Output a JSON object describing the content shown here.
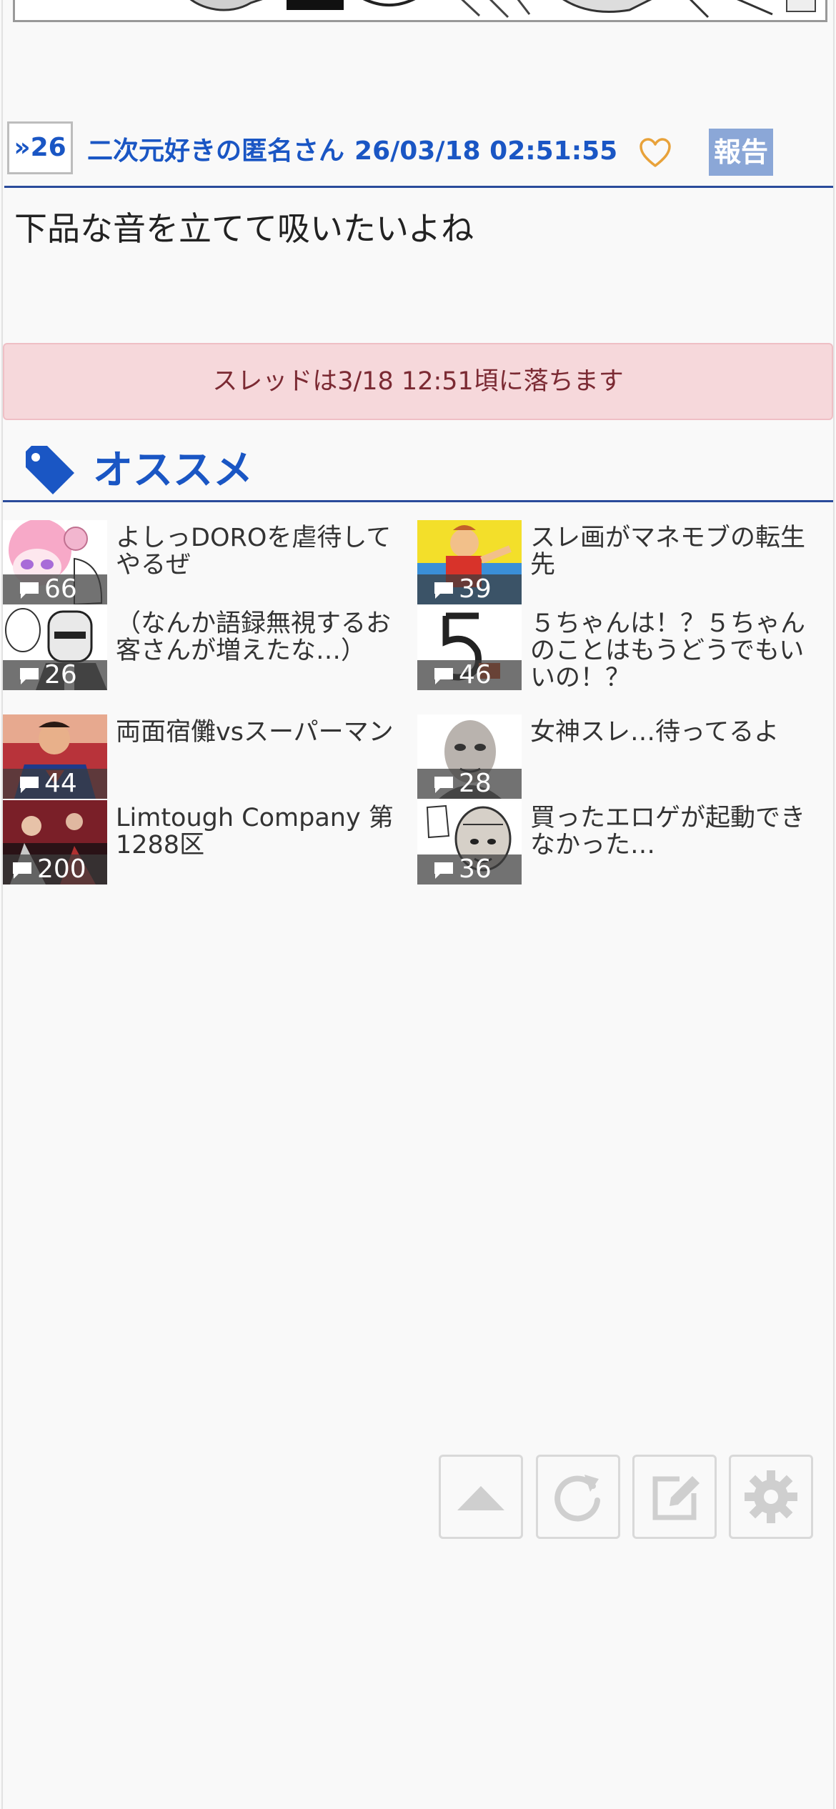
{
  "post": {
    "res_number": "»26",
    "poster_name": "二次元好きの匿名さん",
    "timestamp": "26/03/18 02:51:55",
    "report_label": "報告",
    "body": "下品な音を立てて吸いたいよね"
  },
  "notice": {
    "text": "スレッドは3/18 12:51頃に落ちます"
  },
  "recommend": {
    "heading": "オススメ",
    "items": [
      {
        "title": "よしっDOROを虐待してやるぜ",
        "count": "66"
      },
      {
        "title": "スレ画がマネモブの転生先",
        "count": "39"
      },
      {
        "title": "（なんか語録無視するお客さんが増えたな…）",
        "count": "26"
      },
      {
        "title": "５ちゃんは！？５ちゃんのことはもうどうでもいいの！？",
        "count": "46"
      },
      {
        "title": "両面宿儺vsスーパーマン",
        "count": "44"
      },
      {
        "title": "女神スレ…待ってるよ",
        "count": "28"
      },
      {
        "title": "Limtough Company 第1288区",
        "count": "200"
      },
      {
        "title": "買ったエロゲが起動できなかった…",
        "count": "36"
      }
    ]
  },
  "icons": {
    "fav": "heart-icon",
    "tag": "tag-icon",
    "count": "comment-icon",
    "fab": [
      "scroll-top-icon",
      "reload-icon",
      "edit-icon",
      "settings-icon"
    ]
  },
  "colors": {
    "link_blue": "#1a56c4",
    "divider_blue": "#2a4b9b",
    "heart_orange": "#e8a23a",
    "report_bg": "#8ba7d7",
    "notice_bg": "#f6d8db",
    "notice_text": "#7b2a33"
  }
}
